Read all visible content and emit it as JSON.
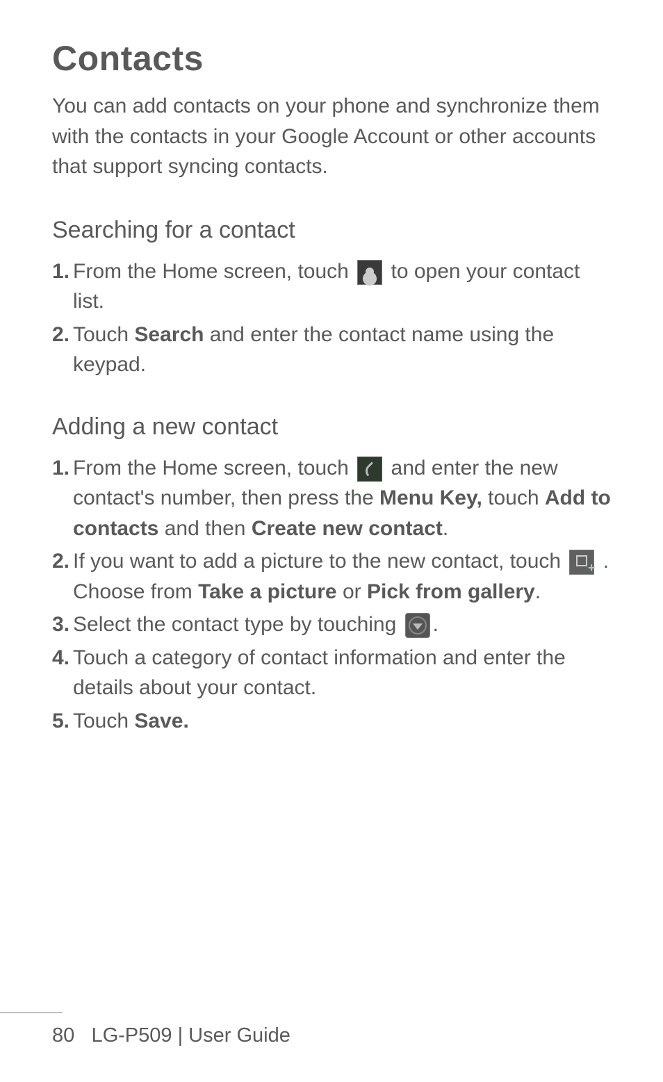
{
  "title": "Contacts",
  "intro": "You can add contacts on your phone and synchronize them with the contacts in your Google Account or other accounts that support syncing contacts.",
  "section1": {
    "heading": "Searching for a contact",
    "items": {
      "n1": "1.",
      "t1a": "From the Home screen, touch ",
      "t1b": " to open your contact list.",
      "n2": "2.",
      "t2a": "Touch ",
      "t2b": "Search",
      "t2c": " and enter the contact name using the keypad."
    }
  },
  "section2": {
    "heading": "Adding a new contact",
    "items": {
      "n1": "1.",
      "t1a": "From the Home screen, touch ",
      "t1b": " and enter the new contact's number, then press the ",
      "t1c": "Menu Key,",
      "t1d": " touch ",
      "t1e": "Add to contacts",
      "t1f": " and then ",
      "t1g": "Create new contact",
      "t1h": ".",
      "n2": "2.",
      "t2a": "If you want to add a picture to the new contact, touch ",
      "t2b": " . Choose from ",
      "t2c": "Take a picture",
      "t2d": " or ",
      "t2e": "Pick from gallery",
      "t2f": ".",
      "n3": "3.",
      "t3a": "Select the contact type by touching ",
      "t3b": ".",
      "n4": "4.",
      "t4a": "Touch a category of contact information and enter the details about your contact.",
      "n5": "5.",
      "t5a": "Touch ",
      "t5b": "Save."
    }
  },
  "footer": {
    "page": "80",
    "model": "LG-P509",
    "sep": "  |  ",
    "label": "User Guide"
  }
}
